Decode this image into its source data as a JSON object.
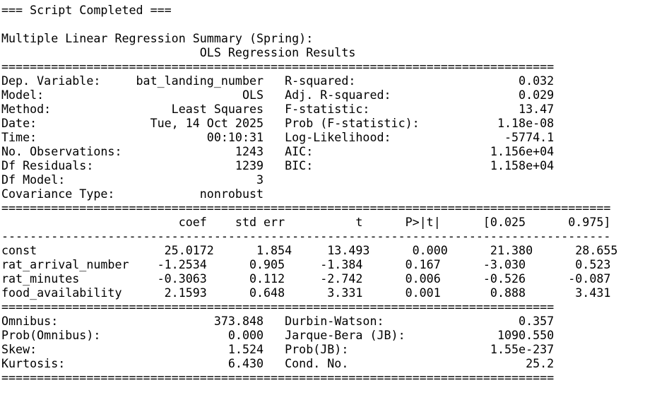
{
  "console": {
    "lines": [
      "=== Script Completed ===",
      "",
      "Multiple Linear Regression Summary (Spring):",
      "                            OLS Regression Results                            ",
      "==============================================================================",
      "Dep. Variable:     bat_landing_number   R-squared:                       0.032",
      "Model:                            OLS   Adj. R-squared:                  0.029",
      "Method:                 Least Squares   F-statistic:                     13.47",
      "Date:                Tue, 14 Oct 2025   Prob (F-statistic):           1.18e-08",
      "Time:                        00:10:31   Log-Likelihood:                -5774.1",
      "No. Observations:                1243   AIC:                         1.156e+04",
      "Df Residuals:                    1239   BIC:                         1.158e+04",
      "Df Model:                           3                                         ",
      "Covariance Type:            nonrobust                                         ",
      "======================================================================================",
      "                         coef    std err          t      P>|t|      [0.025      0.975]",
      "--------------------------------------------------------------------------------------",
      "const                  25.0172      1.854     13.493      0.000      21.380      28.655",
      "rat_arrival_number    -1.2534      0.905     -1.384      0.167      -3.030       0.523",
      "rat_minutes           -0.3063      0.112     -2.742      0.006      -0.526      -0.087",
      "food_availability      2.1593      0.648      3.331      0.001       0.888       3.431",
      "==============================================================================",
      "Omnibus:                      373.848   Durbin-Watson:                   0.357",
      "Prob(Omnibus):                  0.000   Jarque-Bera (JB):             1090.550",
      "Skew:                           1.524   Prob(JB):                    1.55e-237",
      "Kurtosis:                       6.430   Cond. No.                         25.2",
      "=============================================================================="
    ]
  }
}
